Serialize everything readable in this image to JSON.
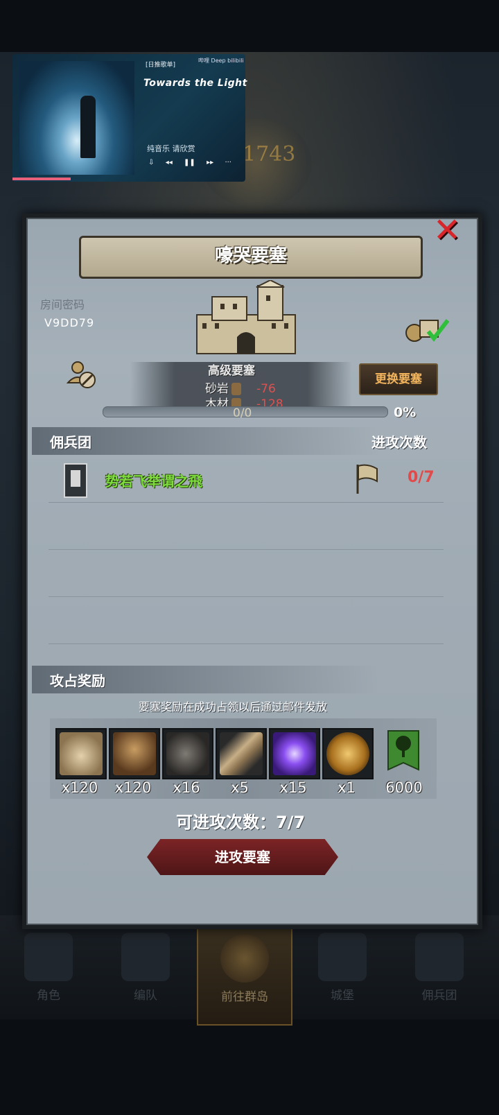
{
  "background": {
    "year": "1743",
    "bottom_nav": [
      {
        "label": "角色",
        "icon": "knight-helmet-icon"
      },
      {
        "label": "编队",
        "icon": "knight-group-icon"
      },
      {
        "label": "前往群岛",
        "icon": "compass-icon",
        "active": true
      },
      {
        "label": "城堡",
        "icon": "castle-icon"
      },
      {
        "label": "佣兵团",
        "icon": "mercenary-icon"
      }
    ]
  },
  "music_widget": {
    "tag": "[日推歌单]",
    "brand": "哔哩 Deep bilibili",
    "title": "Towards the Light",
    "subtitle": "纯音乐 请欣赏",
    "controls": [
      "⇩",
      "◂◂",
      "❚❚",
      "▸▸",
      "···"
    ],
    "progress": 0.25
  },
  "dialog": {
    "title": "嚎哭要塞",
    "close_icon": "close-x-icon",
    "room_label": "房间密码",
    "room_code": "V9DD79",
    "fortress": {
      "grade": "高级要塞",
      "resources": [
        {
          "name": "砂岩",
          "value": "-76"
        },
        {
          "name": "木材",
          "value": "-128"
        }
      ],
      "swap_button": "更换要塞",
      "progress_text": "0/0",
      "progress_percent": "0%"
    },
    "mercenary_section": {
      "title": "佣兵团",
      "count_header": "进攻次数",
      "rows": [
        {
          "name": "势若飞举谓之飛",
          "count": "0/7"
        }
      ]
    },
    "reward_section": {
      "title": "攻占奖励",
      "note": "要塞奖励在成功占领以后通过邮件发放",
      "items": [
        {
          "icon": "coin-bag-icon",
          "qty": "x120",
          "color": "#c9b08a"
        },
        {
          "icon": "goblet-icon",
          "qty": "x120",
          "color": "#a07848"
        },
        {
          "icon": "ore-lump-icon",
          "qty": "x16",
          "color": "#5e5a56"
        },
        {
          "icon": "horn-icon",
          "qty": "x5",
          "color": "#b9a07a"
        },
        {
          "icon": "purple-gem-icon",
          "qty": "x15",
          "color": "#7a46d8"
        },
        {
          "icon": "gold-helmet-icon",
          "qty": "x1",
          "color": "#c4902e"
        },
        {
          "icon": "tree-banner-icon",
          "qty": "6000",
          "color": "#3a7a2c"
        }
      ]
    },
    "attack_left_label": "可进攻次数：7/7",
    "attack_button": "进攻要塞"
  },
  "colors": {
    "panel": "#a0abb4",
    "merc_name": "#7fdc3e",
    "negative": "#e05050",
    "close": "#d8262a",
    "attack_button": "#6a1f21"
  }
}
